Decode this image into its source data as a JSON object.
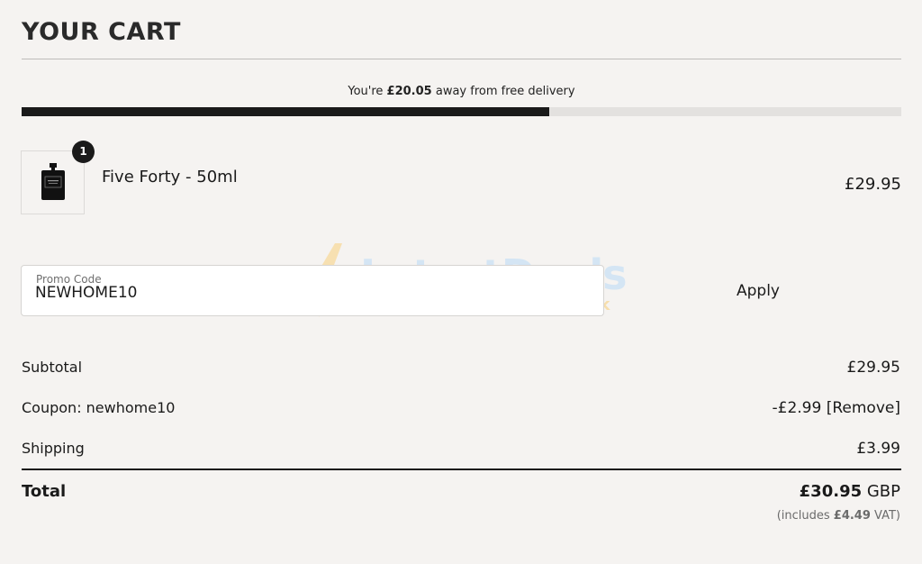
{
  "header": {
    "title": "YOUR CART"
  },
  "delivery": {
    "prefix": "You're ",
    "amount": "£20.05",
    "suffix": " away from free delivery",
    "progress_fraction": 0.6
  },
  "cart": {
    "items": [
      {
        "quantity": "1",
        "name": "Five Forty - 50ml",
        "price": "£29.95"
      }
    ]
  },
  "promo": {
    "label": "Promo Code",
    "value": "NEWHOME10",
    "apply_label": "Apply"
  },
  "watermark": {
    "brand": "LatestDeals",
    "domain": ".co.uk"
  },
  "summary": {
    "subtotal_label": "Subtotal",
    "subtotal_value": "£29.95",
    "coupon_label": "Coupon: newhome10",
    "coupon_value": "-£2.99",
    "remove_label": "[Remove]",
    "shipping_label": "Shipping",
    "shipping_value": "£3.99",
    "total_label": "Total",
    "total_amount": "£30.95",
    "total_currency": " GBP",
    "vat_prefix": "(includes ",
    "vat_amount": "£4.49",
    "vat_suffix": " VAT)"
  },
  "colors": {
    "accent": "#1a1a1a",
    "background": "#f5f3f1",
    "track": "#e3e1df"
  }
}
